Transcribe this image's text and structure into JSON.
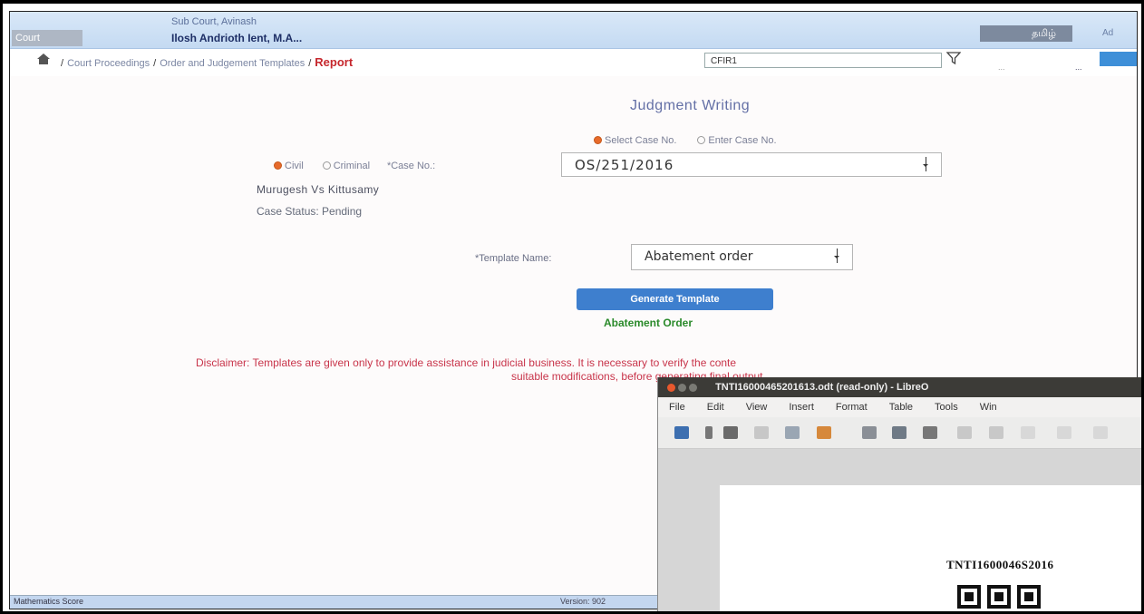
{
  "header": {
    "court_tab": "Court",
    "subtitle": "Sub Court, Avinash",
    "title": "Ilosh Andrioth Ient, M.A...",
    "language_button": "தமிழ்",
    "right_text": "Ad"
  },
  "breadcrumb": {
    "items": [
      "Court Proceedings",
      "Order and Judgement Templates",
      "Report"
    ],
    "search_value": "CFIR1"
  },
  "toolbar_extras": {
    "small_text_1": "...",
    "small_text_2": "..."
  },
  "main": {
    "title": "Judgment Writing",
    "case_mode_options": [
      {
        "label": "Select Case No.",
        "selected": true
      },
      {
        "label": "Enter Case No.",
        "selected": false
      }
    ],
    "case_type_options": [
      {
        "label": "Civil",
        "selected": true
      },
      {
        "label": "Criminal",
        "selected": false
      }
    ],
    "case_no_label": "*Case No.:",
    "case_no_value": "OS/251/2016",
    "parties": "Murugesh Vs Kittusamy",
    "case_status": "Case Status: Pending",
    "template_label": "*Template Name:",
    "template_value": "Abatement order",
    "generate_button": "Generate Template",
    "template_link": "Abatement Order",
    "disclaimer_line1": "Disclaimer: Templates are given only to provide assistance in judicial business. It is necessary to verify the conte",
    "disclaimer_line2": "suitable modifications, before generating final output."
  },
  "statusbar": {
    "left": "Mathematics Score",
    "right": "Version: 902"
  },
  "doc_window": {
    "title": "TNTI16000465201613.odt (read-only) - LibreO",
    "menu": [
      "File",
      "Edit",
      "View",
      "Insert",
      "Format",
      "Table",
      "Tools",
      "Win"
    ],
    "case_code": "TNTI1600046S2016"
  },
  "colors": {
    "header_bg": "#c4daf2",
    "accent_button": "#3e7fce",
    "report_crumb": "#c6272d",
    "disclaimer": "#c8344a",
    "link_green": "#2a8a2a",
    "radio_selected": "#e76a2b"
  }
}
